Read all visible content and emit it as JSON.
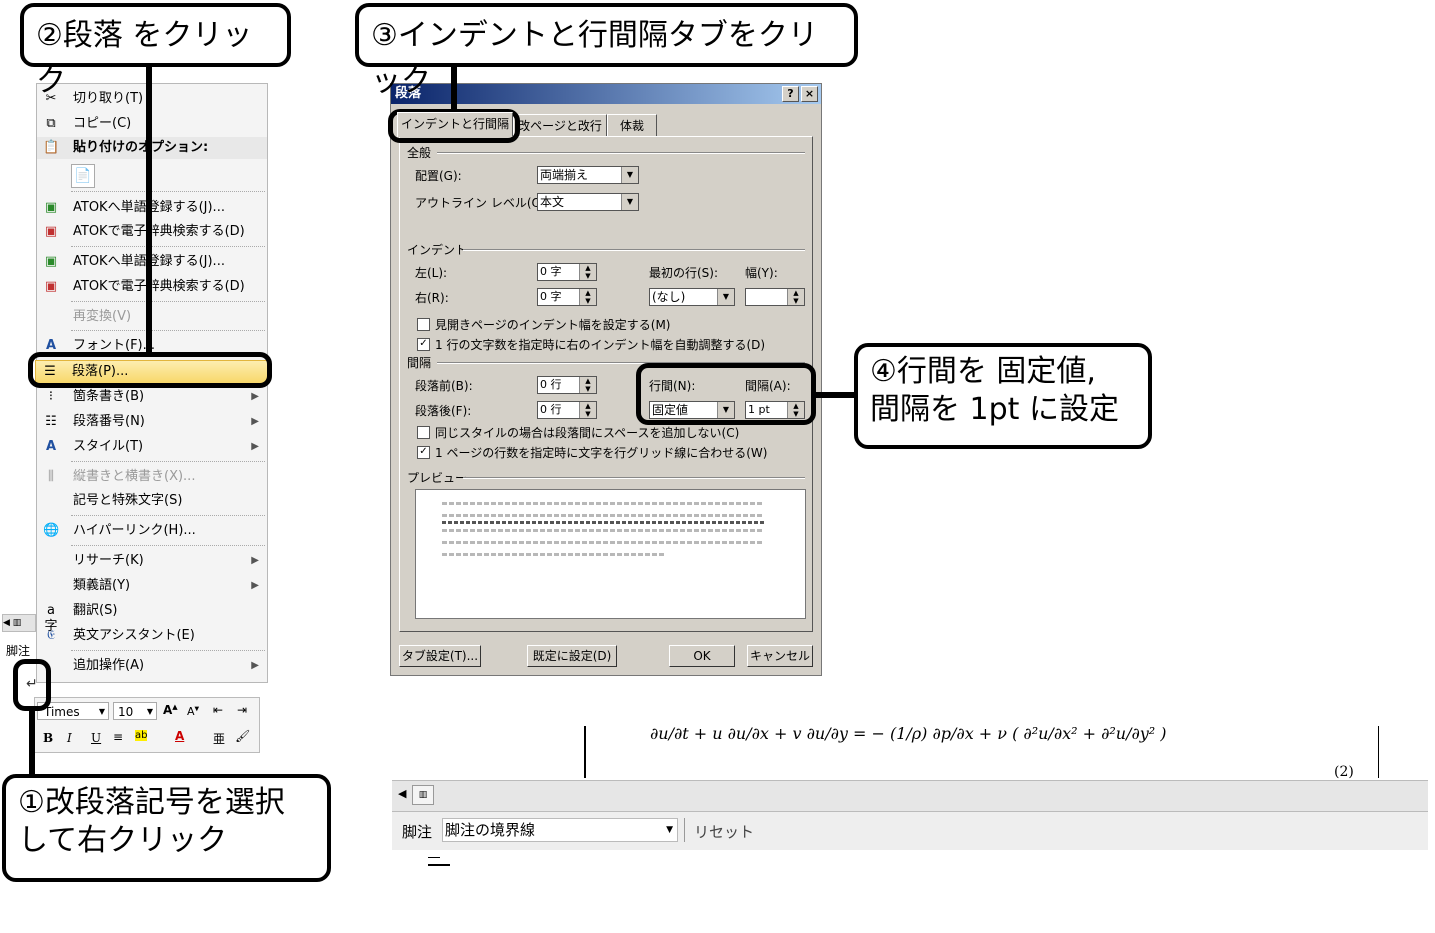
{
  "callouts": {
    "c1": "①改段落記号を選択\nして右クリック",
    "c2": "②段落 をクリック",
    "c3": "③インデントと行間隔タブをクリック",
    "c4": "④行間を 固定値,\n間隔を 1pt に設定"
  },
  "context_menu": {
    "cut": "切り取り(T)",
    "copy": "コピー(C)",
    "paste_options": "貼り付けのオプション:",
    "atok_reg1": "ATOKへ単語登録する(J)...",
    "atok_dict1": "ATOKで電子辞典検索する(D)",
    "atok_reg2": "ATOKへ単語登録する(J)...",
    "atok_dict2": "ATOKで電子辞典検索する(D)",
    "reconvert": "再変換(V)",
    "font": "フォント(F)...",
    "paragraph": "段落(P)...",
    "bullets": "箇条書き(B)",
    "numbering": "段落番号(N)",
    "style": "スタイル(T)",
    "vertical": "縦書きと横書き(X)...",
    "symbols": "記号と特殊文字(S)",
    "hyperlink": "ハイパーリンク(H)...",
    "research": "リサーチ(K)",
    "synonyms": "類義語(Y)",
    "translate": "翻訳(S)",
    "english_assist": "英文アシスタント(E)",
    "more_actions": "追加操作(A)"
  },
  "dialog": {
    "title": "段落",
    "help": "?",
    "close": "×",
    "tabs": [
      "インデントと行間隔",
      "改ページと改行",
      "体裁"
    ],
    "general": "全般",
    "alignment_label": "配置(G):",
    "alignment_value": "両端揃え",
    "outline_label": "アウトライン レベル(O):",
    "outline_value": "本文",
    "indent": "インデント",
    "left_label": "左(L):",
    "left_value": "0 字",
    "right_label": "右(R):",
    "right_value": "0 字",
    "first_line_label": "最初の行(S):",
    "first_line_value": "(なし)",
    "width_label": "幅(Y):",
    "width_value": "",
    "mirror_indent": "見開きページのインデント幅を設定する(M)",
    "auto_indent": "1 行の文字数を指定時に右のインデント幅を自動調整する(D)",
    "spacing": "間隔",
    "before_label": "段落前(B):",
    "before_value": "0 行",
    "after_label": "段落後(F):",
    "after_value": "0 行",
    "line_spacing_label": "行間(N):",
    "line_spacing_value": "固定値",
    "at_label": "間隔(A):",
    "at_value": "1 pt",
    "no_space_same_style": "同じスタイルの場合は段落間にスペースを追加しない(C)",
    "snap_grid": "1 ページの行数を指定時に文字を行グリッド線に合わせる(W)",
    "preview": "プレビュー",
    "tab_settings": "タブ設定(T)...",
    "set_default": "既定に設定(D)",
    "ok": "OK",
    "cancel": "キャンセル"
  },
  "mini_toolbar": {
    "font": "Times",
    "size": "10",
    "bold": "B",
    "italic": "I",
    "underline": "U"
  },
  "word": {
    "footnote_label": "脚注",
    "footnote_select": "脚注の境界線",
    "reset": "リセット",
    "equation_number": "(2)",
    "left_footnote": "脚注"
  }
}
